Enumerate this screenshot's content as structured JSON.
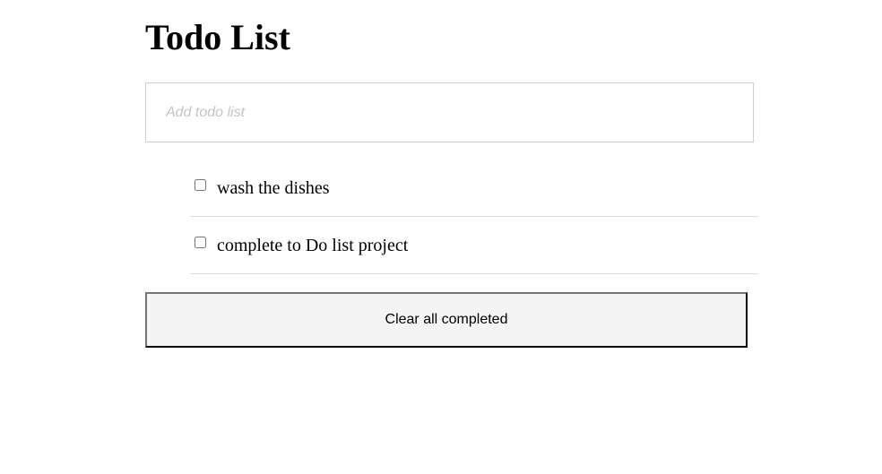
{
  "header": {
    "title": "Todo List"
  },
  "add_input": {
    "placeholder": "Add todo list",
    "value": ""
  },
  "todos": [
    {
      "label": "wash the dishes",
      "checked": false
    },
    {
      "label": "complete to Do list project",
      "checked": false
    }
  ],
  "actions": {
    "clear_label": "Clear all completed"
  }
}
